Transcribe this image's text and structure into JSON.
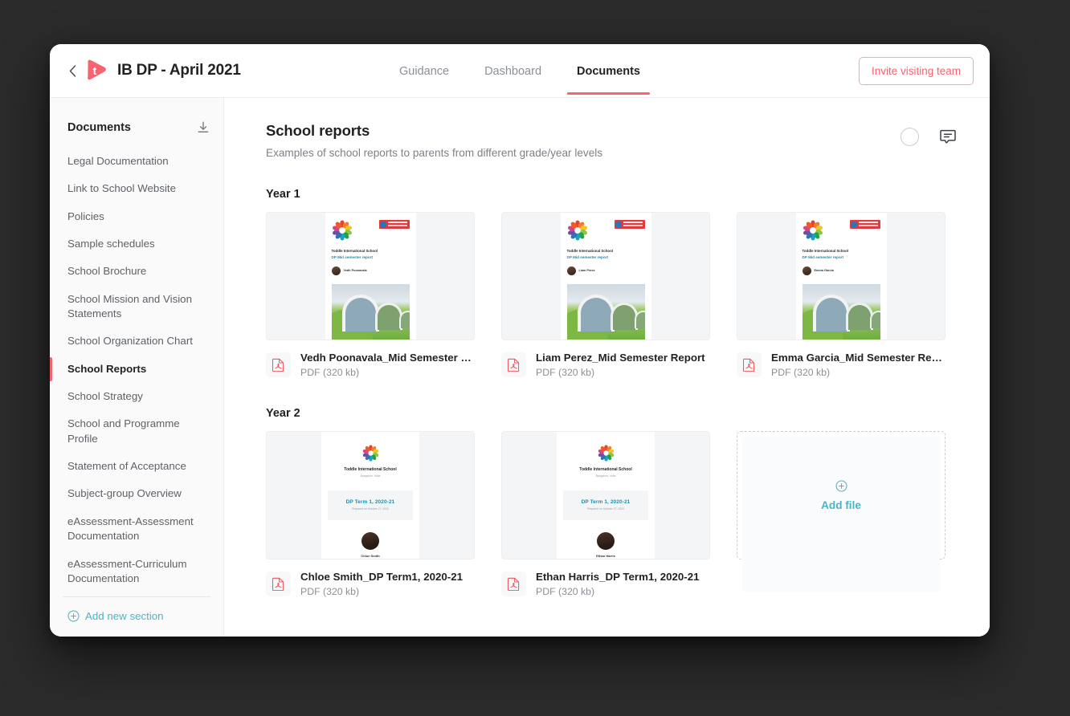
{
  "window": {
    "title": "IB DP - April 2021",
    "logo_letter": "t",
    "logo_color": "#f7636f",
    "back_icon": "chevron-left-icon"
  },
  "nav": {
    "tabs": [
      {
        "label": "Guidance",
        "active": false
      },
      {
        "label": "Dashboard",
        "active": false
      },
      {
        "label": "Documents",
        "active": true
      }
    ],
    "invite_label": "Invite visiting team",
    "accent": "#f7636f"
  },
  "sidebar": {
    "heading": "Documents",
    "download_icon": "download-icon",
    "items": [
      {
        "label": "Legal Documentation",
        "active": false
      },
      {
        "label": "Link to School Website",
        "active": false
      },
      {
        "label": "Policies",
        "active": false
      },
      {
        "label": "Sample schedules",
        "active": false
      },
      {
        "label": "School Brochure",
        "active": false
      },
      {
        "label": "School Mission and Vision Statements",
        "active": false
      },
      {
        "label": "School Organization Chart",
        "active": false
      },
      {
        "label": "School Reports",
        "active": true
      },
      {
        "label": "School Strategy",
        "active": false
      },
      {
        "label": "School and Programme Profile",
        "active": false
      },
      {
        "label": "Statement of Acceptance",
        "active": false
      },
      {
        "label": "Subject-group Overview",
        "active": false
      },
      {
        "label": "eAssessment-Assessment Documentation",
        "active": false
      },
      {
        "label": "eAssessment-Curriculum Documentation",
        "active": false
      }
    ],
    "add_section_label": "Add new section",
    "add_section_color": "#49b5c8"
  },
  "main": {
    "title": "School reports",
    "subtitle": "Examples of school reports to parents from different grade/year levels",
    "avatar_icon": "avatar-circle-icon",
    "comment_icon": "comment-bubble-icon",
    "groups": [
      {
        "label": "Year 1",
        "files": [
          {
            "name": "Vedh Poonavala_Mid Semester Report",
            "size": "PDF (320 kb)",
            "preview_style": "mid-semester",
            "preview": {
              "school": "Toddle International School",
              "report": "DP Mid semester report",
              "student": "Vedh Poonavala"
            }
          },
          {
            "name": "Liam Perez_Mid Semester Report",
            "size": "PDF (320 kb)",
            "preview_style": "mid-semester",
            "preview": {
              "school": "Toddle International School",
              "report": "DP Mid semester report",
              "student": "Liam Perez"
            }
          },
          {
            "name": "Emma Garcia_Mid Semester Report",
            "size": "PDF (320 kb)",
            "preview_style": "mid-semester",
            "preview": {
              "school": "Toddle International School",
              "report": "DP Mid semester report",
              "student": "Emma Garcia"
            }
          }
        ],
        "add_tile": null
      },
      {
        "label": "Year 2",
        "files": [
          {
            "name": "Chloe Smith_DP Term1, 2020-21",
            "size": "PDF (320 kb)",
            "preview_style": "term",
            "preview": {
              "school": "Toddle International School",
              "city": "Bangalore, India",
              "term": "DP Term 1, 2020-21",
              "prepared": "Prepared on October 27, 2020",
              "student": "Chloe Smith"
            }
          },
          {
            "name": "Ethan Harris_DP Term1, 2020-21",
            "size": "PDF (320 kb)",
            "preview_style": "term",
            "preview": {
              "school": "Toddle International School",
              "city": "Bangalore, India",
              "term": "DP Term 1, 2020-21",
              "prepared": "Prepared on October 27, 2020",
              "student": "Ethan Harris"
            }
          }
        ],
        "add_tile": {
          "label": "Add file",
          "icon": "plus-circle-icon"
        }
      }
    ]
  }
}
